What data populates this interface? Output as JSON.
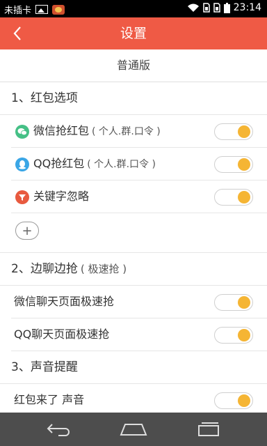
{
  "status_bar": {
    "carrier": "未插卡",
    "time": "23:14",
    "icons": [
      "image-icon",
      "app-notification-icon",
      "wifi-icon",
      "sim-icon",
      "sim-icon",
      "battery-icon"
    ]
  },
  "header": {
    "title": "设置",
    "back_icon": "chevron-left-icon",
    "color": "#ef5a45"
  },
  "version_label": "普通版",
  "sections": {
    "redpacket": {
      "title": "1、红包选项",
      "items": [
        {
          "label": "微信抢红包",
          "sub": "( 个人.群.口令 )",
          "icon": "wechat-icon",
          "on": true
        },
        {
          "label": "QQ抢红包",
          "sub": "( 个人.群.口令 )",
          "icon": "qq-icon",
          "on": true
        },
        {
          "label": "关键字忽略",
          "sub": "",
          "icon": "filter-icon",
          "on": true
        }
      ],
      "add_label": "+"
    },
    "chat_grab": {
      "title": "2、边聊边抢",
      "sub": "( 极速抢 )",
      "items": [
        {
          "label": "微信聊天页面极速抢",
          "on": true
        },
        {
          "label": "QQ聊天页面极速抢",
          "on": true
        }
      ]
    },
    "sound": {
      "title": "3、声音提醒",
      "items": [
        {
          "label": "红包来了 声音",
          "on": true
        }
      ]
    }
  },
  "nav": {
    "back": "back-arrow-icon",
    "home": "home-icon",
    "recents": "recents-icon"
  },
  "toggle_color": "#f5b534"
}
